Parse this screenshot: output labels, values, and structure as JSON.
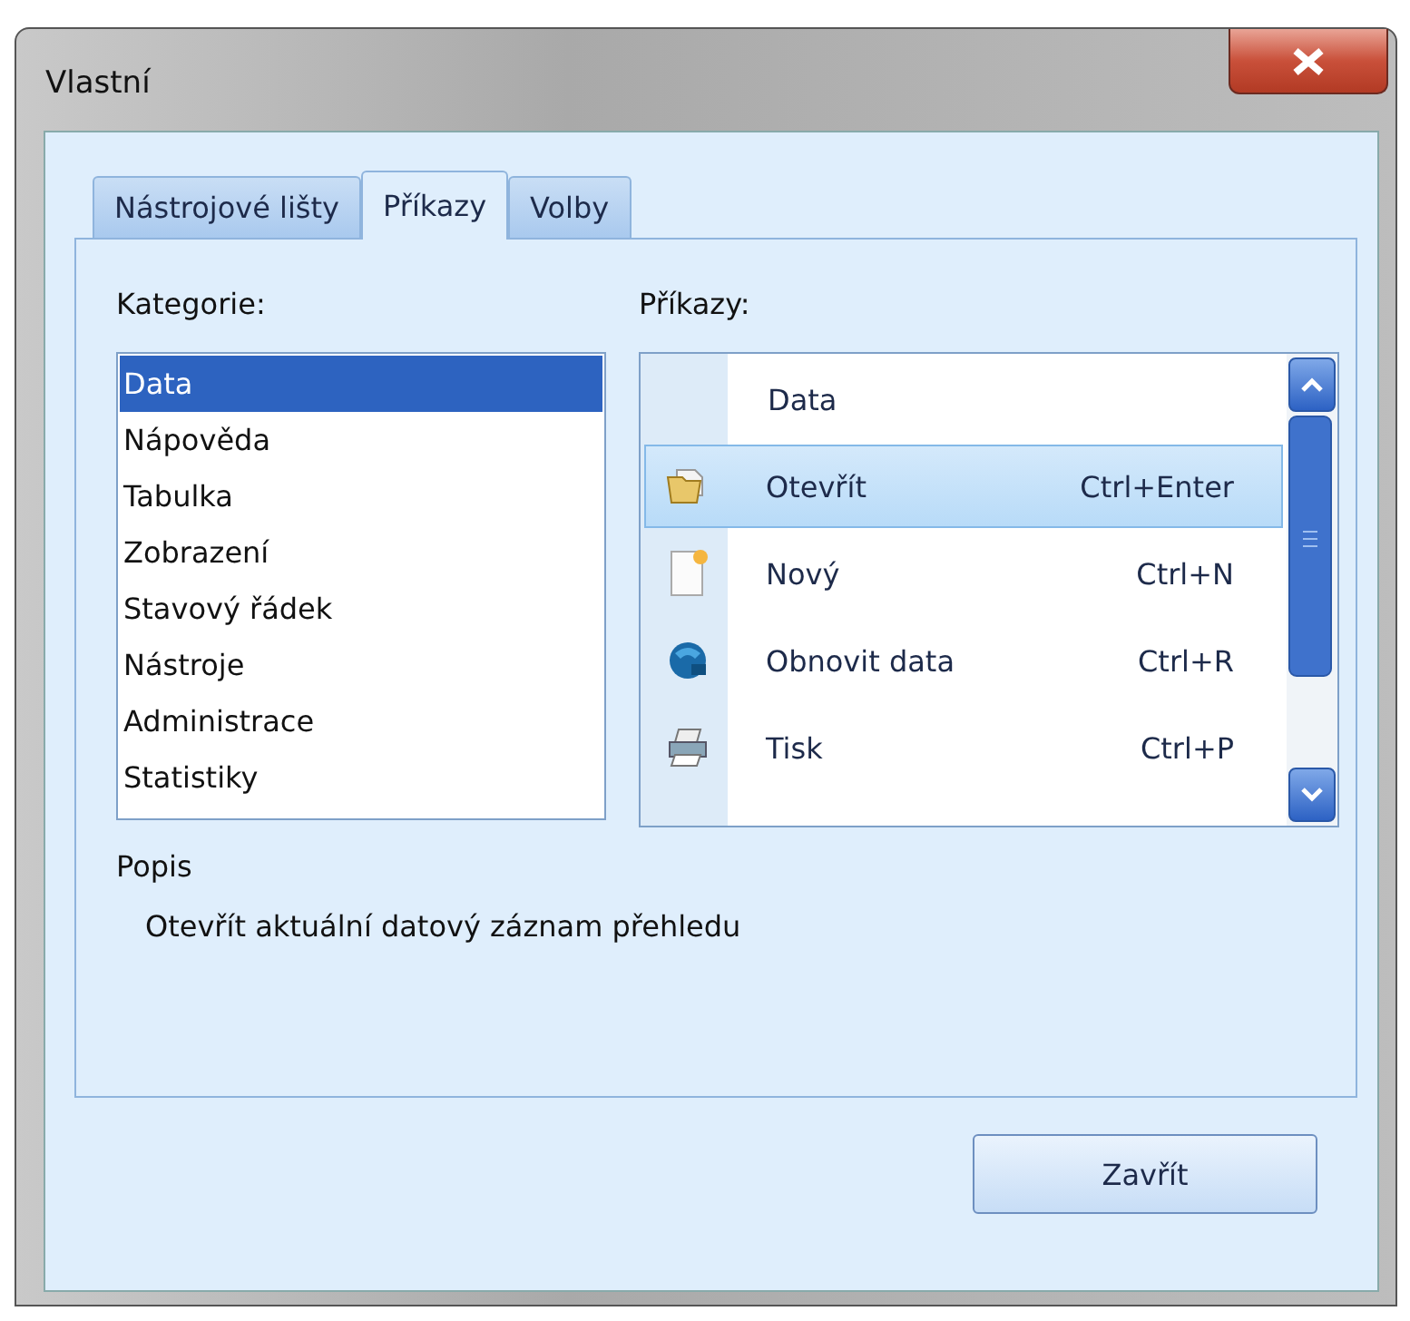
{
  "window": {
    "title": "Vlastní"
  },
  "tabs": [
    {
      "label": "Nástrojové lišty",
      "selected": false
    },
    {
      "label": "Příkazy",
      "selected": true
    },
    {
      "label": "Volby",
      "selected": false
    }
  ],
  "categories": {
    "label": "Kategorie:",
    "items": [
      {
        "label": "Data",
        "selected": true
      },
      {
        "label": "Nápověda",
        "selected": false
      },
      {
        "label": "Tabulka",
        "selected": false
      },
      {
        "label": "Zobrazení",
        "selected": false
      },
      {
        "label": "Stavový řádek",
        "selected": false
      },
      {
        "label": "Nástroje",
        "selected": false
      },
      {
        "label": "Administrace",
        "selected": false
      },
      {
        "label": "Statistiky",
        "selected": false
      }
    ]
  },
  "commands": {
    "label": "Příkazy:",
    "items": [
      {
        "kind": "header",
        "label": "Data"
      },
      {
        "kind": "command",
        "label": "Otevřít",
        "shortcut": "Ctrl+Enter",
        "selected": true
      },
      {
        "kind": "command",
        "label": "Nový",
        "shortcut": "Ctrl+N",
        "selected": false
      },
      {
        "kind": "command",
        "label": "Obnovit data",
        "shortcut": "Ctrl+R",
        "selected": false
      },
      {
        "kind": "command",
        "label": "Tisk",
        "shortcut": "Ctrl+P",
        "selected": false
      }
    ]
  },
  "description": {
    "label": "Popis",
    "text": "Otevřít aktuální datový záznam přehledu"
  },
  "buttons": [
    {
      "label": "Zavřít"
    }
  ]
}
